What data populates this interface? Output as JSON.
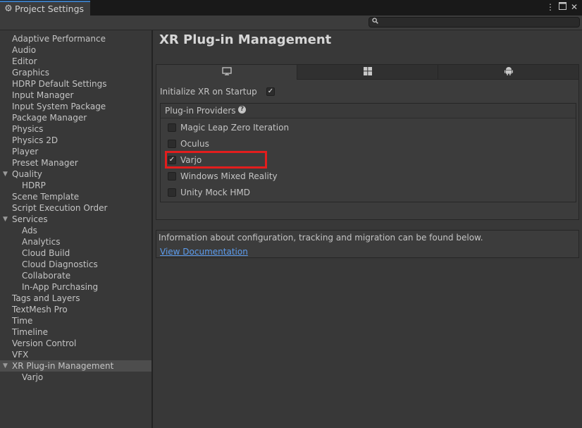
{
  "window": {
    "tab_title": "Project Settings",
    "tab_icon": "gear-icon",
    "menu_icon": "kebab-menu-icon",
    "maximize_icon": "maximize-icon",
    "close_icon": "close-icon",
    "accent_color": "#3a79bb"
  },
  "search": {
    "placeholder": "",
    "icon": "search-icon"
  },
  "sidebar": {
    "items": [
      {
        "label": "Adaptive Performance"
      },
      {
        "label": "Audio"
      },
      {
        "label": "Editor"
      },
      {
        "label": "Graphics"
      },
      {
        "label": "HDRP Default Settings"
      },
      {
        "label": "Input Manager"
      },
      {
        "label": "Input System Package"
      },
      {
        "label": "Package Manager"
      },
      {
        "label": "Physics"
      },
      {
        "label": "Physics 2D"
      },
      {
        "label": "Player"
      },
      {
        "label": "Preset Manager"
      },
      {
        "label": "Quality"
      },
      {
        "label": "HDRP"
      },
      {
        "label": "Scene Template"
      },
      {
        "label": "Script Execution Order"
      },
      {
        "label": "Services"
      },
      {
        "label": "Ads"
      },
      {
        "label": "Analytics"
      },
      {
        "label": "Cloud Build"
      },
      {
        "label": "Cloud Diagnostics"
      },
      {
        "label": "Collaborate"
      },
      {
        "label": "In-App Purchasing"
      },
      {
        "label": "Tags and Layers"
      },
      {
        "label": "TextMesh Pro"
      },
      {
        "label": "Time"
      },
      {
        "label": "Timeline"
      },
      {
        "label": "Version Control"
      },
      {
        "label": "VFX"
      },
      {
        "label": "XR Plug-in Management",
        "selected": true
      },
      {
        "label": "Varjo"
      }
    ]
  },
  "main": {
    "title": "XR Plug-in Management",
    "platform_tabs": [
      {
        "icon": "desktop-icon",
        "active": true
      },
      {
        "icon": "windows-icon",
        "active": false
      },
      {
        "icon": "android-icon",
        "active": false
      }
    ],
    "initialize_label": "Initialize XR on Startup",
    "initialize_checked": true,
    "providers_title": "Plug-in Providers",
    "providers_help_icon": "help-icon",
    "providers": [
      {
        "label": "Magic Leap Zero Iteration",
        "checked": false
      },
      {
        "label": "Oculus",
        "checked": false
      },
      {
        "label": "Varjo",
        "checked": true
      },
      {
        "label": "Windows Mixed Reality",
        "checked": false
      },
      {
        "label": "Unity Mock HMD",
        "checked": false
      }
    ],
    "highlight_color": "#e21d1d",
    "info_text": "Information about configuration, tracking and migration can be found below.",
    "doc_link": "View Documentation",
    "link_color": "#5c9ced"
  }
}
